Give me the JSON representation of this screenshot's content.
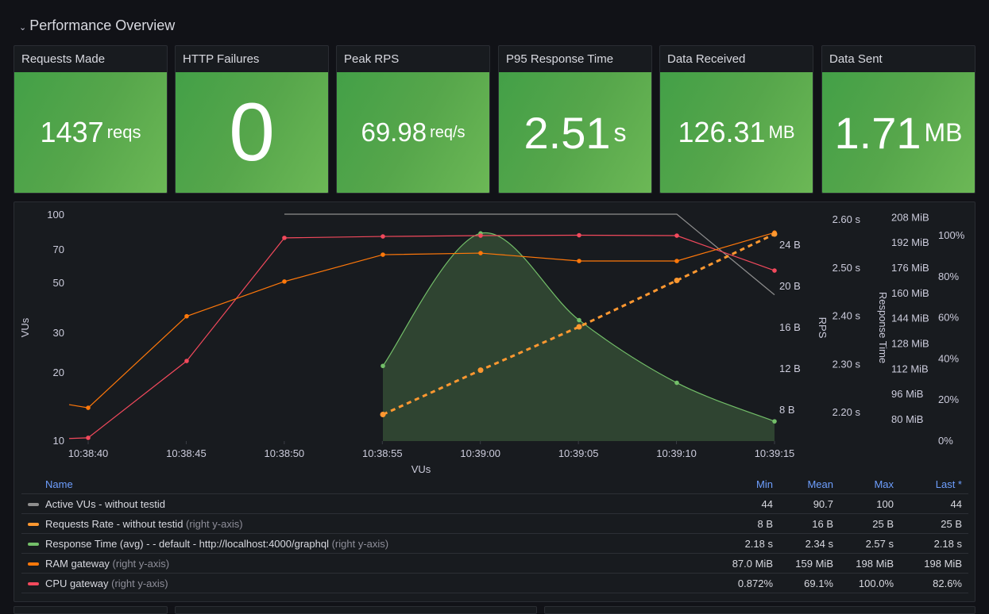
{
  "row": {
    "title": "Performance Overview",
    "chevron_icon": "chevron-down-icon"
  },
  "stats": [
    {
      "title": "Requests Made",
      "value": "1437",
      "unit": "reqs",
      "color": "#56a64b"
    },
    {
      "title": "HTTP Failures",
      "value": "0",
      "unit": "",
      "color": "#56a64b"
    },
    {
      "title": "Peak RPS",
      "value": "69.98",
      "unit": "req/s",
      "color": "#56a64b"
    },
    {
      "title": "P95 Response Time",
      "value": "2.51",
      "unit": "s",
      "color": "#56a64b"
    },
    {
      "title": "Data Received",
      "value": "126.31",
      "unit": "MB",
      "color": "#56a64b"
    },
    {
      "title": "Data Sent",
      "value": "1.71",
      "unit": "MB",
      "color": "#56a64b"
    }
  ],
  "chart_data": {
    "type": "line",
    "title": "",
    "xlabel": "VUs",
    "x": [
      "10:38:39",
      "10:38:40",
      "10:38:45",
      "10:38:50",
      "10:38:55",
      "10:39:00",
      "10:39:05",
      "10:39:10",
      "10:39:15"
    ],
    "x_ticks": [
      "10:38:40",
      "10:38:45",
      "10:38:50",
      "10:38:55",
      "10:39:00",
      "10:39:05",
      "10:39:10",
      "10:39:15"
    ],
    "axes": {
      "left": {
        "label": "VUs",
        "scale": "log",
        "ticks": [
          "100",
          "70",
          "50",
          "30",
          "20",
          "10"
        ],
        "range": [
          10,
          100
        ]
      },
      "rps": {
        "label": "RPS",
        "ticks": [
          "24 B",
          "20 B",
          "16 B",
          "12 B",
          "8 B"
        ],
        "range": [
          7.5,
          25
        ]
      },
      "response_time": {
        "label": "Response Time",
        "ticks": [
          "2.60 s",
          "2.50 s",
          "2.40 s",
          "2.30 s",
          "2.20 s"
        ],
        "range": [
          2.17,
          2.6
        ]
      },
      "ram": {
        "label": "",
        "ticks": [
          "208 MiB",
          "192 MiB",
          "176 MiB",
          "160 MiB",
          "144 MiB",
          "128 MiB",
          "112 MiB",
          "96 MiB",
          "80 MiB"
        ],
        "range": [
          66,
          210
        ]
      },
      "cpu": {
        "label": "",
        "ticks": [
          "100%",
          "80%",
          "60%",
          "40%",
          "20%",
          "0%"
        ],
        "range": [
          0,
          100
        ]
      }
    },
    "series": [
      {
        "name": "Active VUs - without testid",
        "axis": "left",
        "color": "#8e8e8e",
        "style": "solid",
        "points": false,
        "values": [
          null,
          null,
          null,
          100,
          100,
          100,
          100,
          100,
          44
        ]
      },
      {
        "name": "Requests Rate - without testid",
        "axis": "rps",
        "color": "#ff9830",
        "style": "dashed",
        "points": true,
        "values": [
          null,
          null,
          null,
          null,
          7.5,
          11.8,
          16,
          20.5,
          25
        ]
      },
      {
        "name": "Response Time (avg) - - default - http://localhost:4000/graphql",
        "axis": "response_time",
        "color": "#73bf69",
        "style": "smooth-fill",
        "points": true,
        "values": [
          null,
          null,
          null,
          null,
          2.295,
          2.57,
          2.39,
          2.26,
          2.18
        ]
      },
      {
        "name": "RAM gateway",
        "axis": "ram",
        "color": "#ff780a",
        "style": "solid",
        "points": true,
        "values": [
          89,
          87,
          145,
          167,
          184,
          185,
          180,
          180,
          198
        ]
      },
      {
        "name": "CPU gateway",
        "axis": "cpu",
        "color": "#f2495c",
        "style": "solid",
        "points": true,
        "values": [
          0.872,
          1.2,
          38.6,
          98.5,
          99.2,
          99.6,
          99.8,
          99.6,
          82.6
        ]
      }
    ]
  },
  "legend": {
    "headers": {
      "name": "Name",
      "min": "Min",
      "mean": "Mean",
      "max": "Max",
      "last": "Last *"
    },
    "rows": [
      {
        "name": "Active VUs - without testid",
        "suffix": "",
        "color": "#8e8e8e",
        "min": "44",
        "mean": "90.7",
        "max": "100",
        "last": "44"
      },
      {
        "name": "Requests Rate - without testid",
        "suffix": "(right y-axis)",
        "color": "#ff9830",
        "min": "8 B",
        "mean": "16 B",
        "max": "25 B",
        "last": "25 B"
      },
      {
        "name": "Response Time (avg) - - default - http://localhost:4000/graphql",
        "suffix": "(right y-axis)",
        "color": "#73bf69",
        "min": "2.18 s",
        "mean": "2.34 s",
        "max": "2.57 s",
        "last": "2.18 s"
      },
      {
        "name": "RAM gateway",
        "suffix": "(right y-axis)",
        "color": "#ff780a",
        "min": "87.0 MiB",
        "mean": "159 MiB",
        "max": "198 MiB",
        "last": "198 MiB"
      },
      {
        "name": "CPU gateway",
        "suffix": "(right y-axis)",
        "color": "#f2495c",
        "min": "0.872%",
        "mean": "69.1%",
        "max": "100.0%",
        "last": "82.6%"
      }
    ]
  }
}
